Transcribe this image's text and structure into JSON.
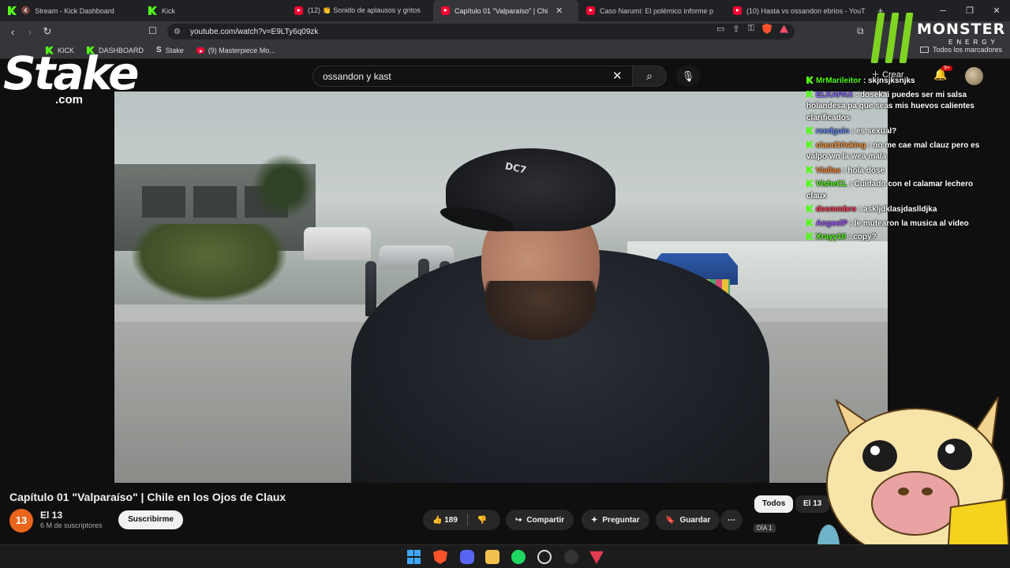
{
  "browser": {
    "tabs": [
      {
        "title": "Stream - Kick Dashboard",
        "icon": "kick-icon",
        "muted": true,
        "active": false
      },
      {
        "title": "Kick",
        "icon": "kick-icon",
        "muted": false,
        "active": false
      },
      {
        "title": "(12) 👏 Sonido de aplausos y gritos",
        "icon": "youtube-icon",
        "muted": false,
        "active": false
      },
      {
        "title": "Capítulo 01 \"Valparaíso\" | Chi",
        "icon": "youtube-icon",
        "muted": false,
        "active": true
      },
      {
        "title": "Caso Narumi: El polémico informe p",
        "icon": "youtube-icon",
        "muted": false,
        "active": false
      },
      {
        "title": "(10) Hasta vs ossandon ebrios - YouT",
        "icon": "youtube-icon",
        "muted": false,
        "active": false
      }
    ],
    "url": "youtube.com/watch?v=E9LTy6q09zk",
    "bookmarks": [
      "KICK",
      "DASHBOARD",
      "Stake",
      "(9) Masterpiece Mo..."
    ],
    "all_bookmarks_label": "Todos los marcadores"
  },
  "youtube": {
    "search_value": "ossandon y kast",
    "create_label": "Crear",
    "notif_badge": "9+",
    "pfp_partial": "P",
    "video_title": "Capítulo 01 \"Valparaíso\" | Chile en los Ojos de Claux",
    "channel": {
      "name": "El 13",
      "subscribers": "6 M de suscriptores",
      "avatar_text": "13"
    },
    "subscribe_label": "Suscribirme",
    "likes": "189",
    "share_label": "Compartir",
    "ask_label": "Preguntar",
    "save_label": "Guardar",
    "chips": [
      "Todos",
      "El 13"
    ],
    "cap_logo": "DC7",
    "thumbnail_badge": "DÍA 1"
  },
  "overlay": {
    "stake_logo": "Stake",
    "stake_domain": ".com",
    "monster_word": "MONSTER",
    "monster_sub": "ENERGY",
    "chat": [
      {
        "user": "MrMarileitor",
        "color": "#53fc18",
        "text": "skjnsjksnjks"
      },
      {
        "user": "ELKAPAX",
        "color": "#8b6cff",
        "text": "dosekai puedes ser mi salsa holandesa pa que seas mis huevos calientes clarificados"
      },
      {
        "user": "reedguin",
        "color": "#6a8cff",
        "text": "es sexual?"
      },
      {
        "user": "claud10sking",
        "color": "#ff9a3c",
        "text": "no me cae mal clauz pero es valpo wn la wea mala"
      },
      {
        "user": "Viallas",
        "color": "#ff8c3a",
        "text": "hola dose"
      },
      {
        "user": "VisheCL",
        "color": "#53fc18",
        "text": "Cuidado con el calamar lechero claux"
      },
      {
        "user": "deemmbro",
        "color": "#ff3b5c",
        "text": "askljdklasjdaslldjka"
      },
      {
        "user": "AngeelP",
        "color": "#a35cff",
        "text": "le mutearon la musica al video"
      },
      {
        "user": "Xrayy16",
        "color": "#53fc18",
        "text": "copy?"
      }
    ]
  },
  "colors": {
    "accent_kick": "#53fc18",
    "youtube_red": "#ff0033",
    "subscribe_bg": "#f1f1f1"
  }
}
